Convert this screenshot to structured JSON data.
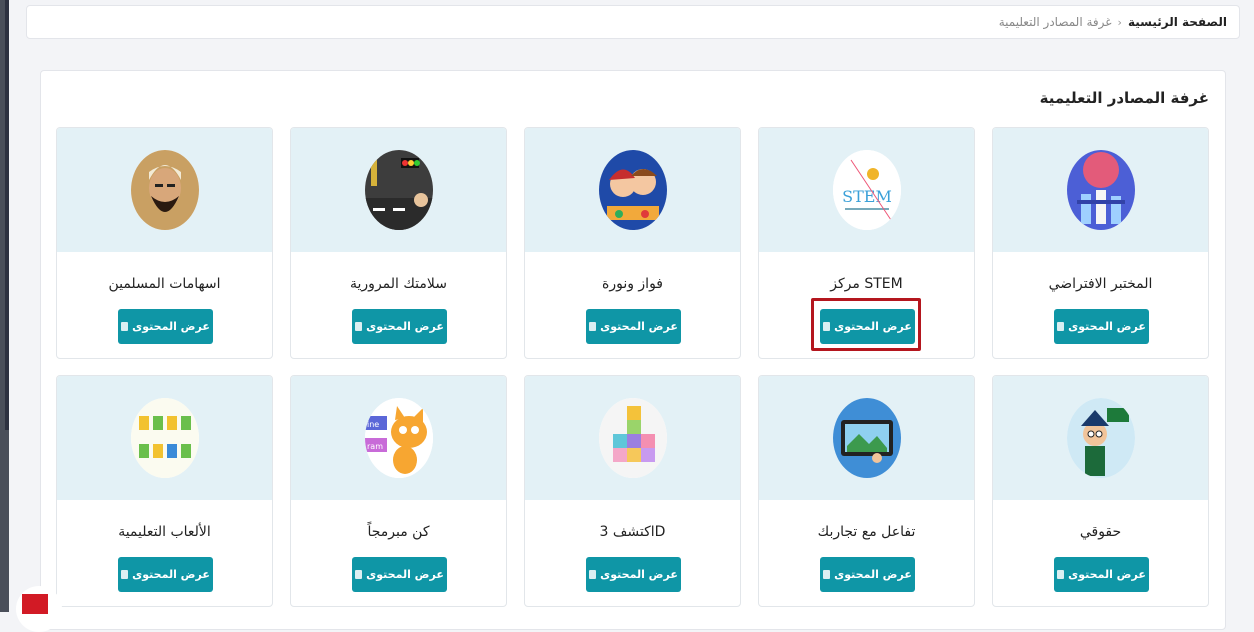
{
  "breadcrumb": {
    "home": "الصفحة الرئيسية",
    "separator": "›",
    "current": "غرفة المصادر التعليمية"
  },
  "panel": {
    "title": "غرفة المصادر التعليمية"
  },
  "button_label": "عرض المحتوى",
  "cards": [
    {
      "title": "المختبر الافتراضي",
      "icon": "virtual-lab-icon"
    },
    {
      "title": "مركز STEM",
      "icon": "stem-logo-icon",
      "logo_text": "STEM"
    },
    {
      "title": "فواز ونورة",
      "icon": "fawaz-noura-icon"
    },
    {
      "title": "سلامتك المرورية",
      "icon": "traffic-light-icon"
    },
    {
      "title": "اسهامات المسلمين",
      "icon": "muslim-scholar-icon"
    },
    {
      "title": "حقوقي",
      "icon": "my-rights-icon"
    },
    {
      "title": "تفاعل مع تجاربك",
      "icon": "interactive-tablet-icon"
    },
    {
      "title": "اكتشف 3D",
      "icon": "cubes-3d-icon"
    },
    {
      "title": "كن مبرمجاً",
      "icon": "scratch-cat-icon",
      "logo_text": [
        "ine",
        "ram"
      ]
    },
    {
      "title": "الألعاب التعليمية",
      "icon": "educational-games-icon"
    }
  ],
  "highlighted_card": "مركز STEM"
}
